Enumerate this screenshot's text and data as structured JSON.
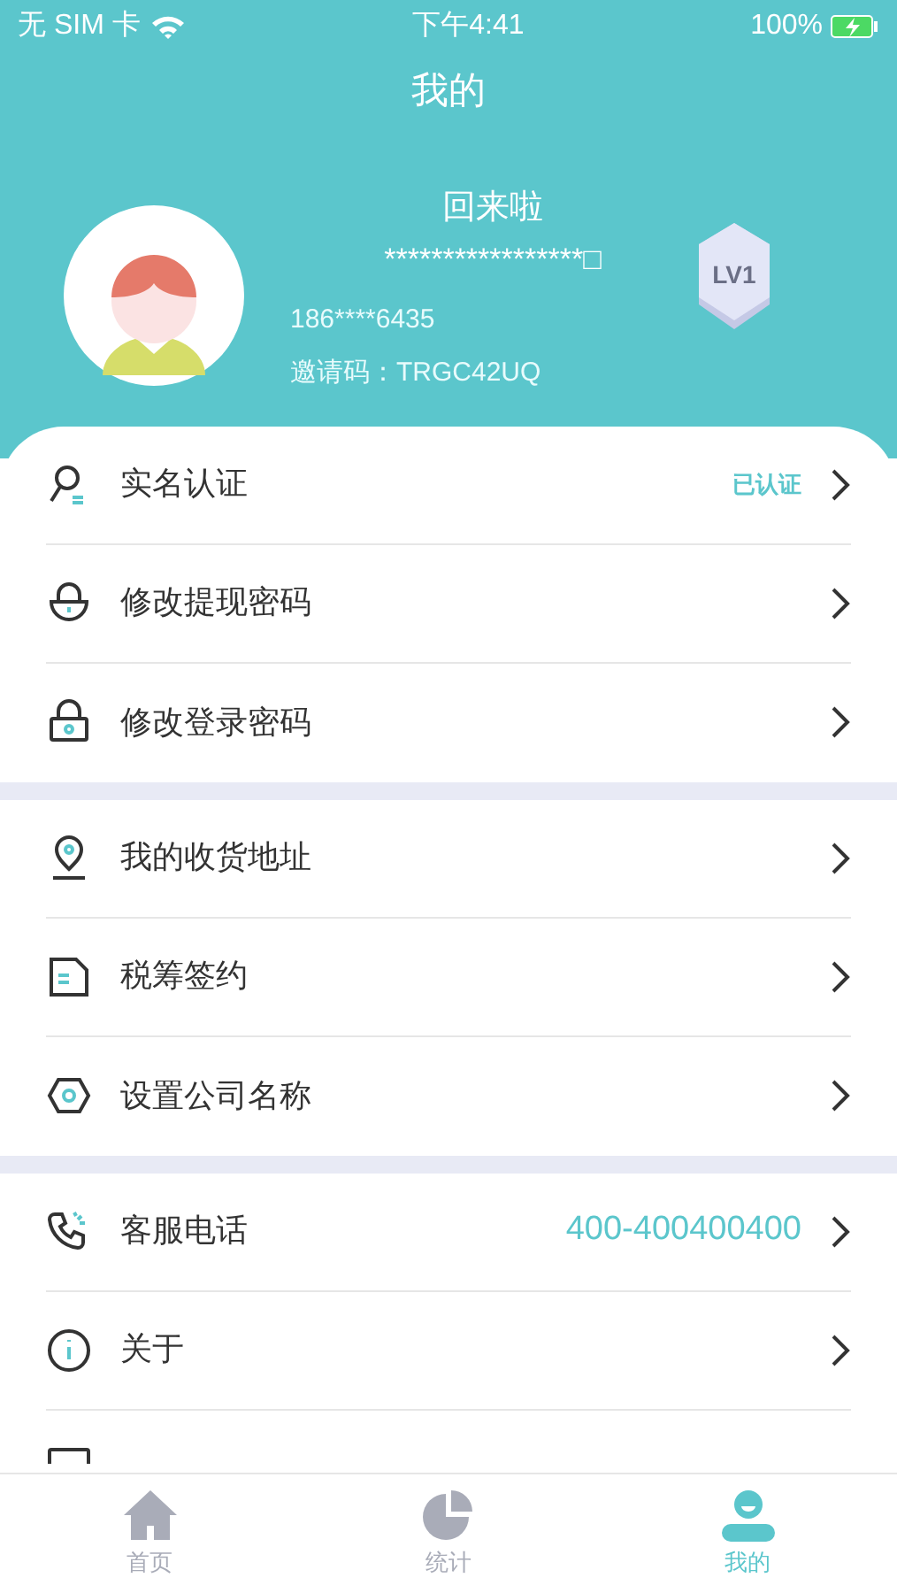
{
  "status_bar": {
    "carrier": "无 SIM 卡",
    "time": "下午4:41",
    "battery": "100%"
  },
  "title": "我的",
  "profile": {
    "name": "回来啦",
    "masked_id": "*****************□",
    "phone": "186****6435",
    "invite_code": "邀请码：TRGC42UQ",
    "level_badge": "LV1"
  },
  "sections": [
    [
      {
        "label": "实名认证",
        "value": {
          "text": "已认证",
          "kind": "status"
        }
      },
      {
        "label": "修改提现密码"
      },
      {
        "label": "修改登录密码"
      }
    ],
    [
      {
        "label": "我的收货地址"
      },
      {
        "label": "税筹签约"
      },
      {
        "label": "设置公司名称"
      }
    ],
    [
      {
        "label": "客服电话",
        "value": {
          "text": "400-400400400",
          "kind": "phone"
        }
      },
      {
        "label": "关于"
      }
    ]
  ],
  "tabs": [
    {
      "label": "首页",
      "selected": false
    },
    {
      "label": "统计",
      "selected": false
    },
    {
      "label": "我的",
      "selected": true
    }
  ]
}
